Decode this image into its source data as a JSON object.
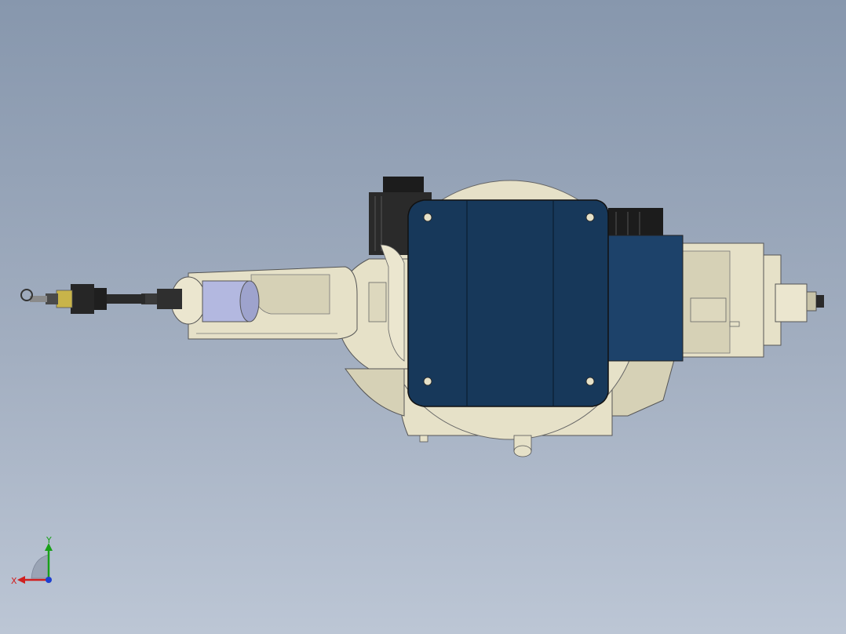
{
  "viewport": {
    "background_top": "#8797ad",
    "background_bottom": "#bcc6d5"
  },
  "model": {
    "colors": {
      "body_cream": "#e6e1c8",
      "body_shadow": "#c8c3a8",
      "motor_blue": "#17385a",
      "motor_black": "#1c1c1c",
      "tool_gold": "#c8b44a",
      "tool_dark": "#2a2a2a",
      "lens_lavender": "#b3b8e0"
    }
  },
  "triad": {
    "x_label": "X",
    "y_label": "Y",
    "x_color": "#d02020",
    "y_color": "#18a018",
    "z_color": "#1d3fd0"
  }
}
